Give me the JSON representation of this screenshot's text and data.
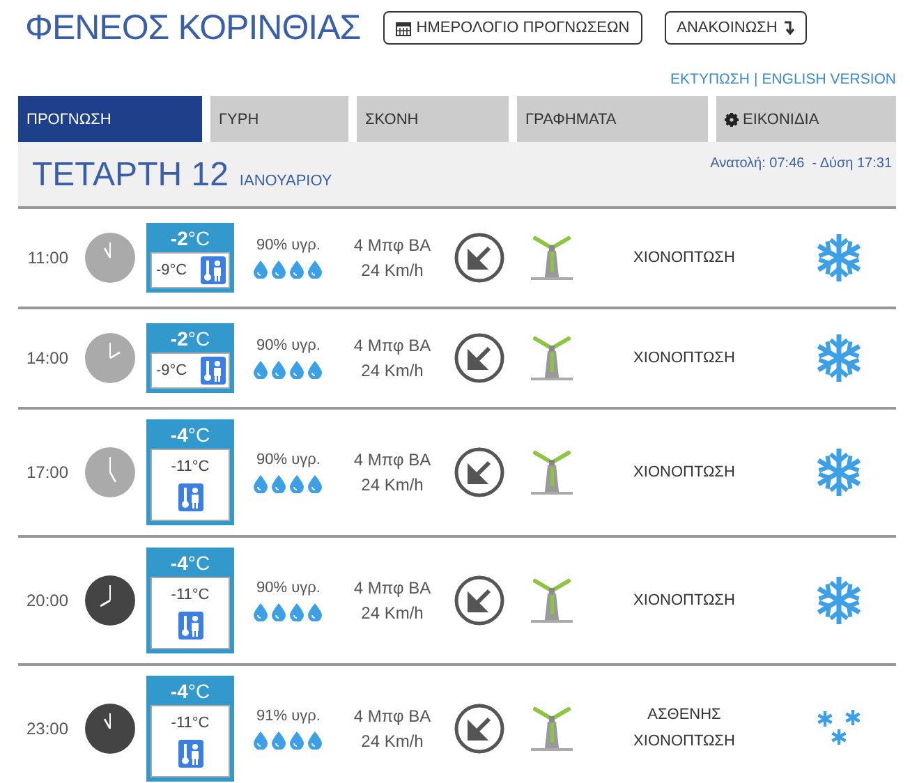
{
  "header": {
    "title": "ΦΕΝΕΟΣ ΚΟΡΙΝΘΙΑΣ",
    "buttons": [
      {
        "label": "ΗΜΕΡΟΛΟΓΙΟ ΠΡΟΓΝΩΣΕΩΝ",
        "kind": "calendar"
      },
      {
        "label": "ΑΝΑΚΟΙΝΩΣΗ",
        "kind": "arrow"
      }
    ],
    "links": [
      "ΕΚΤΥΠΩΣΗ",
      "ENGLISH VERSION"
    ],
    "separator": "|"
  },
  "tabs": [
    {
      "label": "ΠΡΟΓΝΩΣΗ",
      "selected": true,
      "kind": "plain"
    },
    {
      "label": "ΓΥΡΗ",
      "selected": false,
      "kind": "plain"
    },
    {
      "label": "ΣΚΟΝΗ",
      "selected": false,
      "kind": "plain"
    },
    {
      "label": "ΓΡΑΦΗΜΑΤΑ",
      "selected": false,
      "kind": "plain"
    },
    {
      "label": "ΕΙΚΟΝΙΔΙΑ",
      "selected": false,
      "kind": "gear"
    }
  ],
  "day": {
    "weekday": "ΤΕΤΑΡΤΗ 12",
    "month": "ΙΑΝΟΥΑΡΙΟΥ",
    "sun": "Ανατολή: 07:46  - Δύση 17:31"
  },
  "rows": [
    {
      "time": "11:00",
      "night": false,
      "kind": "compact",
      "temp": "-2",
      "unit": "°C",
      "feels": "-9°C",
      "humidity": "90% υγρ.",
      "wind": "4 Μπφ ΒΑ",
      "speed": "24 Km/h",
      "condition": "ΧΙΟΝΟΠΤΩΣΗ",
      "heavy": true
    },
    {
      "time": "14:00",
      "night": false,
      "kind": "compact",
      "temp": "-2",
      "unit": "°C",
      "feels": "-9°C",
      "humidity": "90% υγρ.",
      "wind": "4 Μπφ ΒΑ",
      "speed": "24 Km/h",
      "condition": "ΧΙΟΝΟΠΤΩΣΗ",
      "heavy": true
    },
    {
      "time": "17:00",
      "night": false,
      "kind": "tall",
      "temp": "-4",
      "unit": "°C",
      "feels": "-11°C",
      "humidity": "90% υγρ.",
      "wind": "4 Μπφ ΒΑ",
      "speed": "24 Km/h",
      "condition": "ΧΙΟΝΟΠΤΩΣΗ",
      "heavy": true
    },
    {
      "time": "20:00",
      "night": true,
      "kind": "tall",
      "temp": "-4",
      "unit": "°C",
      "feels": "-11°C",
      "humidity": "90% υγρ.",
      "wind": "4 Μπφ ΒΑ",
      "speed": "24 Km/h",
      "condition": "ΧΙΟΝΟΠΤΩΣΗ",
      "heavy": true
    },
    {
      "time": "23:00",
      "night": true,
      "kind": "tall",
      "temp": "-4",
      "unit": "°C",
      "feels": "-11°C",
      "humidity": "91% υγρ.",
      "wind": "4 Μπφ ΒΑ",
      "speed": "24 Km/h",
      "condition": "ΑΣΘΕΝΗΣ ΧΙΟΝΟΠΤΩΣΗ",
      "heavy": false
    }
  ]
}
